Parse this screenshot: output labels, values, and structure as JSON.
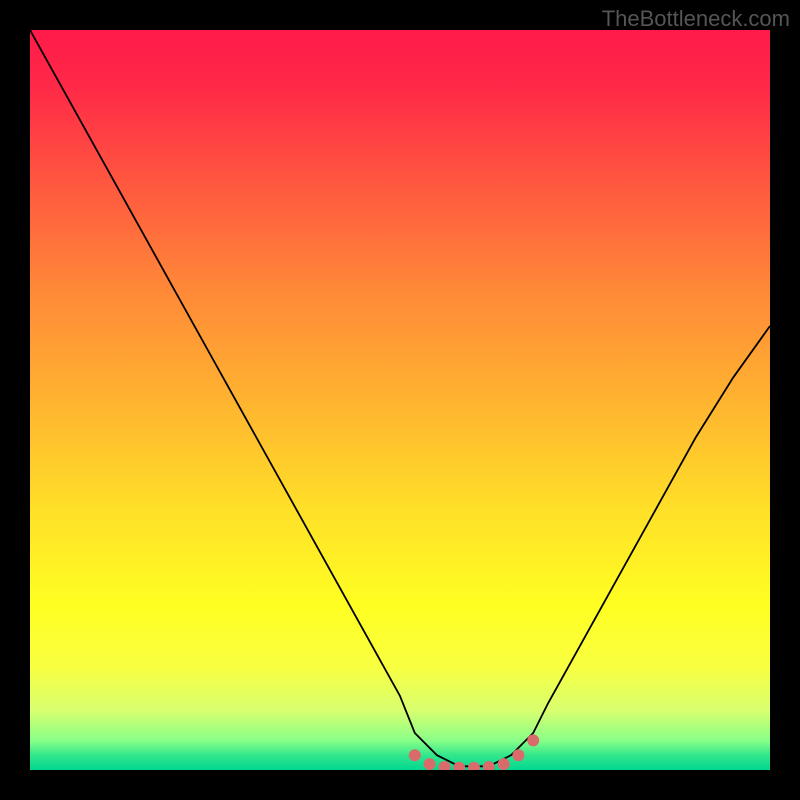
{
  "watermark": "TheBottleneck.com",
  "chart_data": {
    "type": "line",
    "title": "",
    "xlabel": "",
    "ylabel": "",
    "xlim": [
      0,
      100
    ],
    "ylim": [
      0,
      100
    ],
    "series": [
      {
        "name": "curve",
        "x": [
          0,
          5,
          10,
          15,
          20,
          25,
          30,
          35,
          40,
          45,
          50,
          52,
          55,
          58,
          62,
          65,
          68,
          70,
          75,
          80,
          85,
          90,
          95,
          100
        ],
        "values": [
          100,
          91,
          82,
          73,
          64,
          55,
          46,
          37,
          28,
          19,
          10,
          5,
          2,
          0.5,
          0.5,
          2,
          5,
          9,
          18,
          27,
          36,
          45,
          53,
          60
        ]
      },
      {
        "name": "markers",
        "x": [
          52,
          54,
          56,
          58,
          60,
          62,
          64,
          66,
          68
        ],
        "values": [
          2,
          0.8,
          0.4,
          0.3,
          0.3,
          0.4,
          0.8,
          2,
          4
        ]
      }
    ],
    "colors": {
      "curve": "#000000",
      "markers": "#d96b6b"
    }
  }
}
